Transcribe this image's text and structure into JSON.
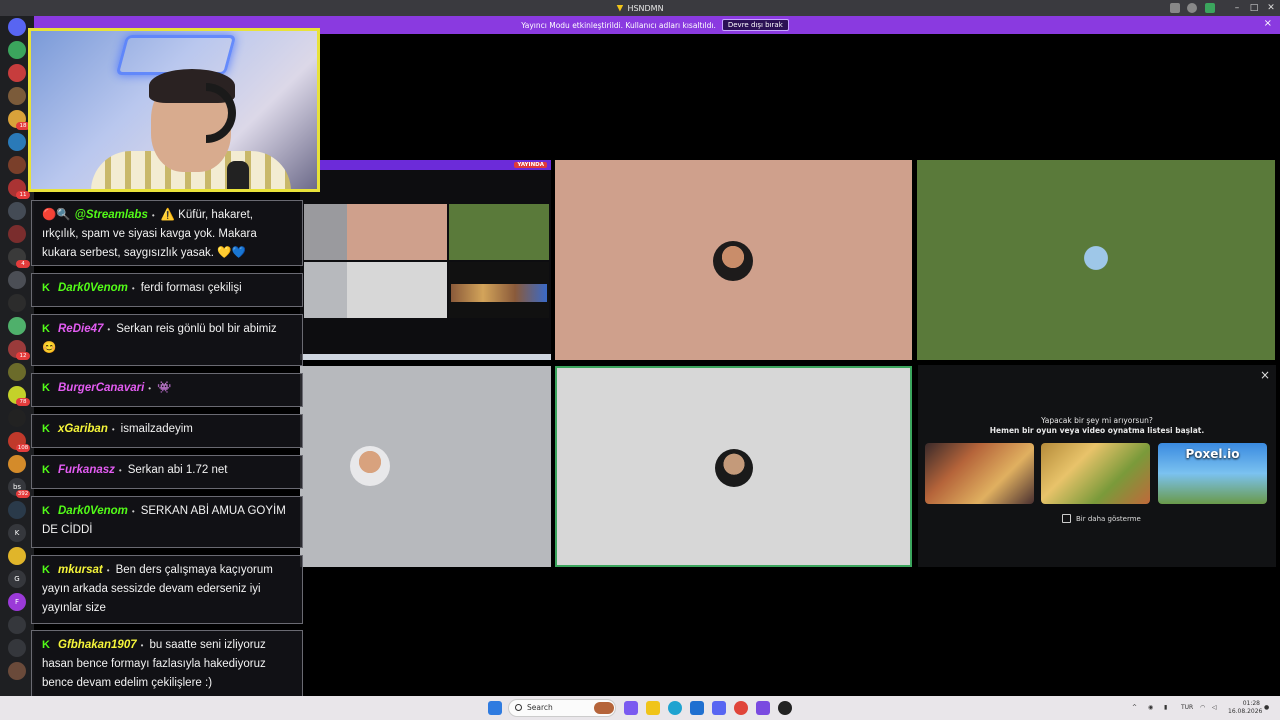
{
  "window": {
    "title": "HSNDMN"
  },
  "banner": {
    "text": "Yayıncı Modu etkinleştirildi. Kullanıcı adları kısaltıldı.",
    "button_label": "Devre dışı bırak",
    "close_label": "×"
  },
  "servers": [
    {
      "label": "",
      "color": "#5865f2"
    },
    {
      "label": "",
      "color": "#3ba55d"
    },
    {
      "label": "",
      "color": "#c73d3d"
    },
    {
      "label": "",
      "color": "#7b5b3a"
    },
    {
      "label": "",
      "color": "#d9a23a"
    },
    {
      "label": "",
      "color": "#2a7ab8"
    },
    {
      "label": "",
      "color": "#7a3f2a"
    },
    {
      "label": "",
      "color": "#aa3333"
    },
    {
      "label": "",
      "color": "#444b55"
    },
    {
      "label": "",
      "color": "#7a2d2d"
    },
    {
      "label": "",
      "color": "#3a3a3a"
    },
    {
      "label": "",
      "color": "#4b4e55"
    },
    {
      "label": "",
      "color": "#2c2c2c"
    },
    {
      "label": "",
      "color": "#4fb06b"
    },
    {
      "label": "",
      "color": "#9a3b3b"
    },
    {
      "label": "",
      "color": "#6b6b2a"
    },
    {
      "label": "",
      "color": "#c4d12a"
    },
    {
      "label": "",
      "color": "#222"
    },
    {
      "label": "",
      "color": "#c0392b"
    },
    {
      "label": "",
      "color": "#d48b2a"
    },
    {
      "label": "bs",
      "color": "#35373c"
    },
    {
      "label": "",
      "color": "#2a3a4a"
    },
    {
      "label": "K",
      "color": "#35373c"
    },
    {
      "label": "",
      "color": "#e0b52a"
    },
    {
      "label": "G",
      "color": "#35373c"
    },
    {
      "label": "F",
      "color": "#9b3ad8"
    },
    {
      "label": "",
      "color": "#35373c"
    },
    {
      "label": "",
      "color": "#35373c"
    },
    {
      "label": "",
      "color": "#6a4a3a"
    }
  ],
  "badges": [
    "18",
    "11",
    "4",
    "12",
    "78",
    "108",
    "392"
  ],
  "mini_window": {
    "live_label": "YAYINDA"
  },
  "promo": {
    "close_label": "×",
    "line1": "Yapacak bir şey mi arıyorsun?",
    "line2": "Hemen bir oyun veya video oynatma listesi başlat.",
    "games": [
      "",
      "",
      "Poxel.io"
    ],
    "checkbox_label": "Bir daha gösterme"
  },
  "chat": [
    {
      "user": "@Streamlabs",
      "user_color": "#53fc18",
      "text": "⚠️ Küfür, hakaret, ırkçılık, spam ve siyasi kavga yok. Makara kukara serbest, saygısızlık yasak. 💛💙",
      "prefix": "🔴🔍"
    },
    {
      "user": "Dark0Venom",
      "user_color": "#53fc18",
      "text": "ferdi forması çekilişi"
    },
    {
      "user": "ReDie47",
      "user_color": "#e35cf2",
      "text": "Serkan reis gönlü bol bir abimiz 😊"
    },
    {
      "user": "BurgerCanavari",
      "user_color": "#e35cf2",
      "text": "👾"
    },
    {
      "user": "xGariban",
      "user_color": "#f5f53a",
      "text": "ismailzadeyim"
    },
    {
      "user": "Furkanasz",
      "user_color": "#e35cf2",
      "text": "Serkan abi 1.72 net"
    },
    {
      "user": "Dark0Venom",
      "user_color": "#53fc18",
      "text": "SERKAN ABİ AMUA GOYİM DE CİDDİ"
    },
    {
      "user": "mkursat",
      "user_color": "#f5f53a",
      "text": "Ben ders çalışmaya kaçıyorum yayın arkada sessizde devam ederseniz iyi yayınlar size"
    },
    {
      "user": "Gfbhakan1907",
      "user_color": "#f5f53a",
      "text": "bu saatte seni izliyoruz hasan bence formayı fazlasıyla hakediyoruz bence devam edelim çekilişlere :)"
    }
  ],
  "taskbar": {
    "search_placeholder": "Search",
    "lang": "TUR",
    "time": "01:28",
    "date": "16.08.2026"
  }
}
